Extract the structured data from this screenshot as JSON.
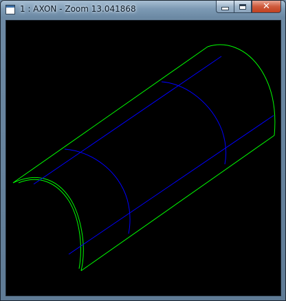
{
  "window": {
    "title": "1 : AXON - Zoom 13.041868",
    "icon": "app-icon",
    "controls": {
      "minimize": "minimize-icon",
      "maximize": "maximize-icon",
      "close": "close-icon",
      "close_glyph": "✕"
    }
  },
  "viewport": {
    "background": "#000000",
    "outline_color": "#00ff00",
    "section_color": "#0000ff"
  }
}
